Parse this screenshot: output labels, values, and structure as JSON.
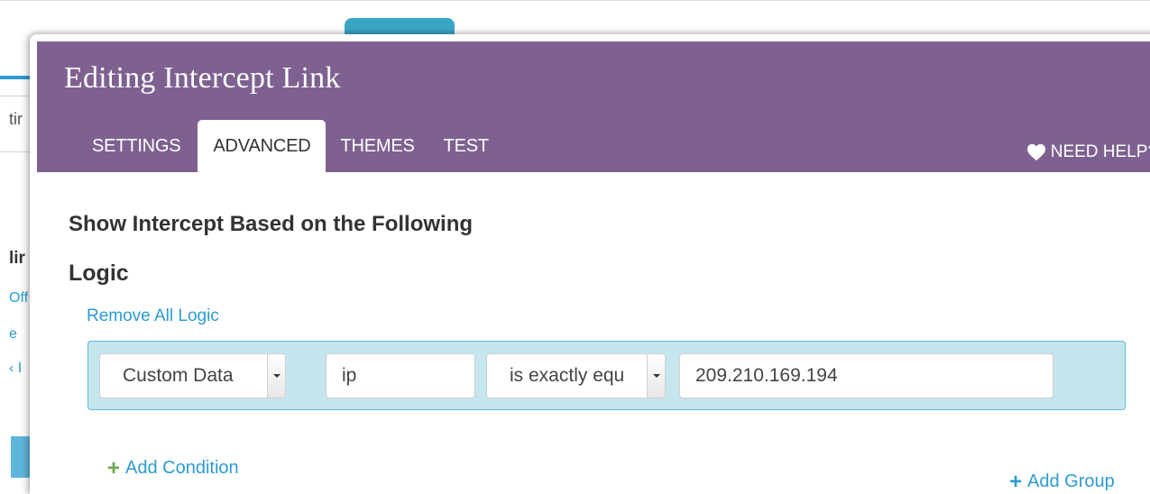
{
  "background": {
    "fragments": [
      "tir",
      "lir",
      "Off",
      "e",
      "‹ I"
    ]
  },
  "modal": {
    "title": "Editing Intercept Link",
    "tabs": [
      {
        "label": "SETTINGS",
        "active": false
      },
      {
        "label": "ADVANCED",
        "active": true
      },
      {
        "label": "THEMES",
        "active": false
      },
      {
        "label": "TEST",
        "active": false
      }
    ],
    "help_label": "NEED HELP?",
    "help_icon": "heart-icon"
  },
  "advanced": {
    "section_title": "Show Intercept Based on the Following",
    "logic_title": "Logic",
    "remove_all_logic": "Remove All Logic",
    "condition": {
      "field_select": "Custom Data",
      "key_input": "ip",
      "operator_select": "is exactly equal to",
      "operator_visible": "is exactly equ",
      "value_input": "209.210.169.194"
    },
    "add_condition": "Add Condition",
    "add_group": "Add Group"
  },
  "colors": {
    "header_purple": "#7e6190",
    "link_blue": "#2c9bd0",
    "condition_bg": "#c6e6ee",
    "plus_green": "#6aa84f"
  }
}
